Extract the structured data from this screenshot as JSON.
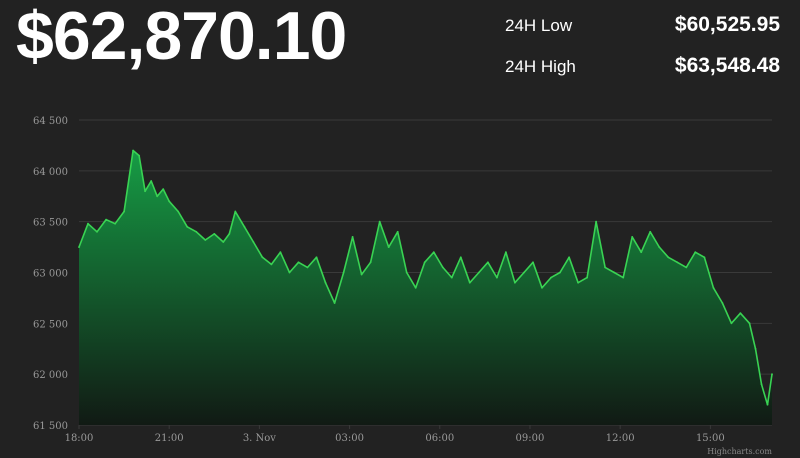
{
  "header": {
    "price": "$62,870.10",
    "low_label": "24H Low",
    "low_value": "$60,525.95",
    "high_label": "24H High",
    "high_value": "$63,548.48"
  },
  "credits": "Highcharts.com",
  "colors": {
    "background": "#222222",
    "line": "#39d353",
    "fill_top": "#169c45",
    "fill_bottom": "#111a14",
    "grid": "#3a3a3a",
    "text": "#ffffff",
    "tick": "#999999"
  },
  "chart_data": {
    "type": "area",
    "title": "",
    "xlabel": "",
    "ylabel": "",
    "ylim": [
      61500,
      64500
    ],
    "y_ticks": [
      61500,
      62000,
      62500,
      63000,
      63500,
      64000,
      64500
    ],
    "y_tick_labels": [
      "61 500",
      "62 000",
      "62 500",
      "63 000",
      "63 500",
      "64 000",
      "64 500"
    ],
    "xlim": [
      0,
      23.05
    ],
    "x_unit": "hours after 18:00",
    "x_ticks": [
      0,
      3,
      6,
      9,
      12,
      15,
      18,
      21
    ],
    "x_tick_labels": [
      "18:00",
      "21:00",
      "3. Nov",
      "03:00",
      "06:00",
      "09:00",
      "12:00",
      "15:00"
    ],
    "grid": true,
    "legend": "none",
    "series": [
      {
        "x": [
          0,
          0.3,
          0.6,
          0.9,
          1.2,
          1.5,
          1.8,
          2.0,
          2.2,
          2.4,
          2.6,
          2.8,
          3.0,
          3.3,
          3.6,
          3.9,
          4.2,
          4.5,
          4.8,
          5.0,
          5.2,
          5.5,
          5.8,
          6.1,
          6.4,
          6.7,
          7.0,
          7.3,
          7.6,
          7.9,
          8.2,
          8.5,
          8.8,
          9.1,
          9.4,
          9.7,
          10.0,
          10.3,
          10.6,
          10.9,
          11.2,
          11.5,
          11.8,
          12.1,
          12.4,
          12.7,
          13.0,
          13.3,
          13.6,
          13.9,
          14.2,
          14.5,
          14.8,
          15.1,
          15.4,
          15.7,
          16.0,
          16.3,
          16.6,
          16.9,
          17.2,
          17.5,
          17.8,
          18.1,
          18.4,
          18.7,
          19.0,
          19.3,
          19.6,
          19.9,
          20.2,
          20.5,
          20.8,
          21.1,
          21.4,
          21.7,
          22.0,
          22.3,
          22.5,
          22.7,
          22.9,
          23.05
        ],
        "y": [
          63250,
          63480,
          63400,
          63520,
          63480,
          63600,
          64200,
          64150,
          63800,
          63900,
          63750,
          63820,
          63700,
          63600,
          63450,
          63400,
          63320,
          63380,
          63300,
          63380,
          63600,
          63450,
          63300,
          63150,
          63080,
          63200,
          63000,
          63100,
          63050,
          63150,
          62900,
          62700,
          63000,
          63350,
          62980,
          63100,
          63500,
          63250,
          63400,
          63000,
          62850,
          63100,
          63200,
          63050,
          62950,
          63150,
          62900,
          63000,
          63100,
          62950,
          63200,
          62900,
          63000,
          63100,
          62850,
          62950,
          63000,
          63150,
          62900,
          62950,
          63500,
          63050,
          63000,
          62950,
          63350,
          63200,
          63400,
          63250,
          63150,
          63100,
          63050,
          63200,
          63150,
          62850,
          62700,
          62500,
          62600,
          62500,
          62250,
          61900,
          61700,
          62000
        ]
      }
    ]
  }
}
